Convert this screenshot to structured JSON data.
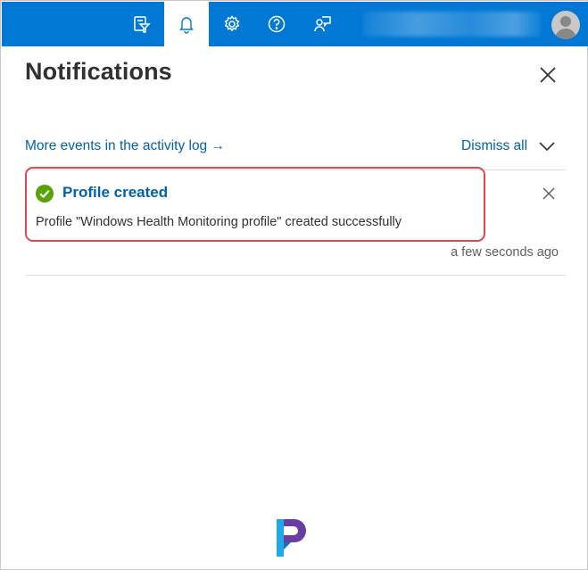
{
  "topbar": {
    "accent_color": "#0078d4",
    "icons": [
      "directory-filter-icon",
      "bell-icon",
      "gear-icon",
      "help-icon",
      "feedback-icon"
    ],
    "active_icon": "bell-icon",
    "avatar_icon": "user-avatar-icon"
  },
  "panel": {
    "title": "Notifications",
    "activity_link": "More events in the activity log →",
    "dismiss_all": "Dismiss all"
  },
  "notifications": [
    {
      "status": "success",
      "status_color": "#57a300",
      "title": "Profile created",
      "message": "Profile \"Windows Health Monitoring profile\" created successfully",
      "time": "a few seconds ago"
    }
  ],
  "colors": {
    "link": "#0062ad",
    "highlight": "#e2474c"
  }
}
